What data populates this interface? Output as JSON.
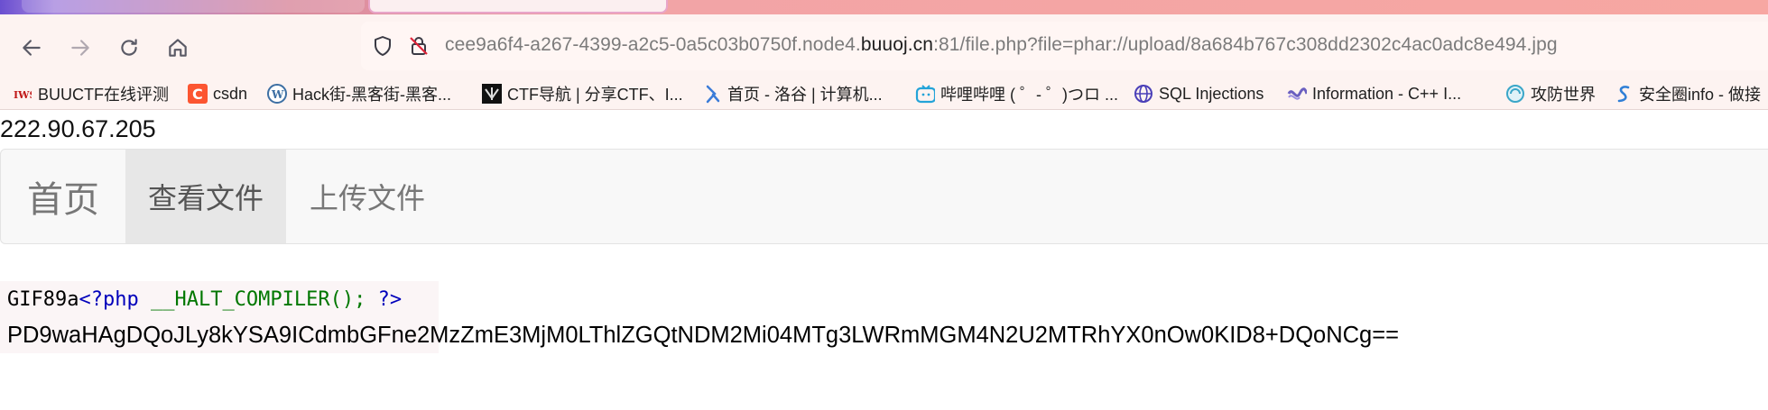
{
  "browser": {
    "url": {
      "prefix": "cee9a6f4-a267-4399-a2c5-0a5c03b0750f.node4.",
      "domain": "buuoj.cn",
      "suffix": ":81/file.php?file=phar://upload/8a684b767c308dd2302c4ac0adc8e494.jpg"
    },
    "bookmarks": [
      {
        "label": "BUUCTF在线评测",
        "icon": "buuctf-icon"
      },
      {
        "label": "csdn",
        "icon": "csdn-icon"
      },
      {
        "label": "Hack街-黑客街-黑客...",
        "icon": "wordpress-icon"
      },
      {
        "label": "CTF导航 | 分享CTF、I...",
        "icon": "ctf-nav-icon"
      },
      {
        "label": "首页 - 洛谷 | 计算机...",
        "icon": "luogu-icon"
      },
      {
        "label": "哔哩哔哩 ( ゜- ゜)つロ ...",
        "icon": "bilibili-icon"
      },
      {
        "label": "SQL Injections",
        "icon": "globe-icon"
      },
      {
        "label": "Information - C++ I...",
        "icon": "cplusplus-icon"
      },
      {
        "label": "攻防世界",
        "icon": "adworld-icon"
      },
      {
        "label": "安全圈info - 做接",
        "icon": "anquanquan-icon"
      }
    ]
  },
  "page": {
    "ip": "222.90.67.205",
    "nav": {
      "brand": "首页",
      "view": "查看文件",
      "upload": "上传文件"
    },
    "code": {
      "gif_header": "GIF89a",
      "php_open": "<?php",
      "halt": "__HALT_COMPILER();",
      "php_close": "?>"
    },
    "base64_output": "PD9waHAgDQoJLy8kYSA9ICdmbGFne2MzZmE3MjM0LThlZGQtNDM2Mi04MTg3LWRmMGM4N2U2MTRhYX0nOw0KID8+DQoNCg=="
  },
  "colors": {
    "php_tag": "#0000bb",
    "php_function": "#007700",
    "navbar_bg": "#f8f8f8",
    "nav_active_bg": "#e7e7e7"
  }
}
